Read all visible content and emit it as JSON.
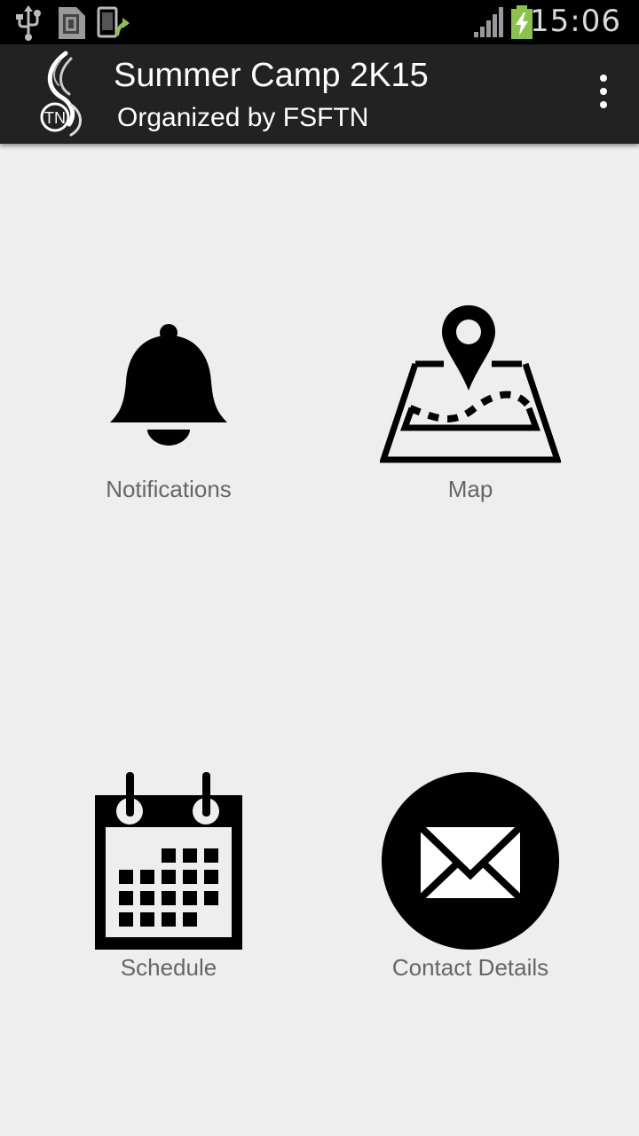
{
  "status_bar": {
    "time": "15:06",
    "icons": [
      "usb-icon",
      "sd-card-icon",
      "screen-share-icon",
      "signal-icon",
      "battery-charging-icon"
    ]
  },
  "action_bar": {
    "title": "Summer Camp 2K15",
    "subtitle": "Organized by FSFTN",
    "logo_text": "TN",
    "menu_icon": "overflow-menu-icon"
  },
  "tiles": [
    {
      "label": "Notifications",
      "icon": "bell-icon"
    },
    {
      "label": "Map",
      "icon": "map-icon"
    },
    {
      "label": "Schedule",
      "icon": "calendar-icon"
    },
    {
      "label": "Contact Details",
      "icon": "envelope-icon"
    }
  ],
  "colors": {
    "status_bar_bg": "#000000",
    "action_bar_bg": "#222222",
    "content_bg": "#eeeeee",
    "label_text": "#666666",
    "battery_accent": "#8bc34a"
  }
}
